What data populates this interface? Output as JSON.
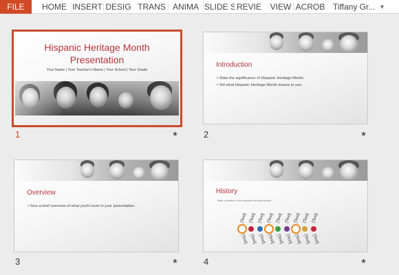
{
  "ribbon": {
    "tabs": [
      "FILE",
      "HOME",
      "INSERT",
      "DESIG",
      "TRANS",
      "ANIMA",
      "SLIDE S",
      "REVIE",
      "VIEW",
      "ACROB"
    ],
    "user": "Tiffany Gr..."
  },
  "slides": [
    {
      "number": "1",
      "selected": true,
      "title_line1": "Hispanic Heritage Month",
      "title_line2": "Presentation",
      "subtitle": "Your Name | Your Teacher's Name | Your School | Your Grade"
    },
    {
      "number": "2",
      "title": "Introduction",
      "bullets": [
        "• State the significance of Hispanic Heritage Month.",
        "• Tell what Hispanic Heritage Month means to you."
      ]
    },
    {
      "number": "3",
      "title": "Overview",
      "bullets": [
        "• Give a brief overview of what you'll cover in your presentation."
      ]
    },
    {
      "number": "4",
      "title": "History",
      "note": "Make a timeline of the important historical events.",
      "timeline_text": "[Text]",
      "dot_colors": [
        "#e88b1e",
        "#c0283c",
        "#2b6db3",
        "#e88b1e",
        "#3aa14a",
        "#7a3f8c",
        "#e88b1e",
        "#d5a13a",
        "#c0283c"
      ]
    }
  ],
  "star_icon": "★",
  "caret_icon": "▼",
  "colors": {
    "accent": "#c94a2a",
    "title_red": "#b3343a",
    "ribbon_file": "#d04a26"
  }
}
